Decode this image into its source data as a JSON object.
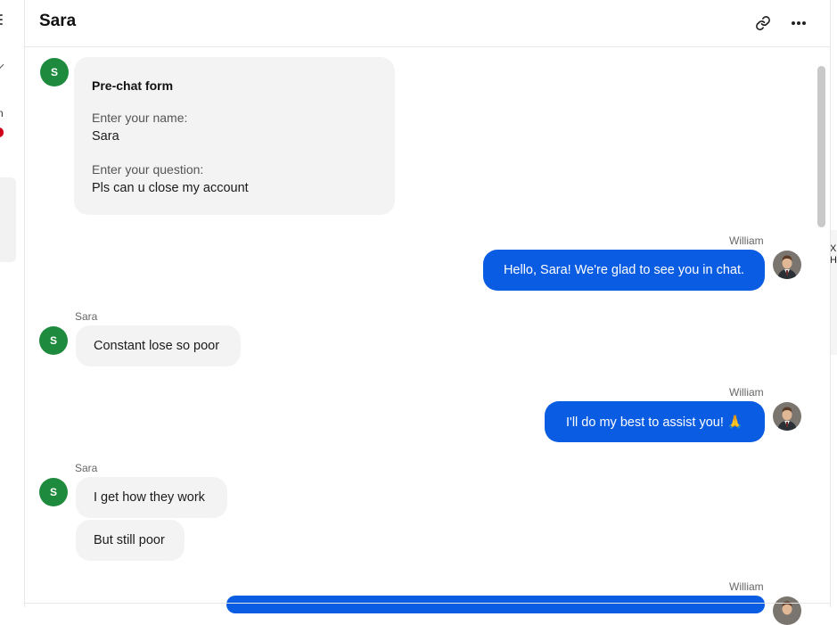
{
  "header": {
    "title": "Sara",
    "icons": [
      "link-icon",
      "more-icon"
    ]
  },
  "left_pane": {
    "letter": "n"
  },
  "right_pane": {
    "text_line1": "XI",
    "text_line2": "H"
  },
  "visitor": {
    "name": "Sara",
    "avatar_initial": "S",
    "avatar_color": "#1e8a3e"
  },
  "agent": {
    "name": "William"
  },
  "prechat_form": {
    "title": "Pre-chat form",
    "name_label": "Enter your name:",
    "name_value": "Sara",
    "question_label": "Enter your question:",
    "question_value": "Pls can u close my account"
  },
  "messages": [
    {
      "from": "William",
      "text": "Hello, Sara! We're glad to see you in chat."
    },
    {
      "from": "Sara",
      "text": "Constant lose so poor"
    },
    {
      "from": "William",
      "text": "I'll do my best to assist you! 🙏"
    },
    {
      "from": "Sara",
      "text": "I get how they work"
    },
    {
      "from": "Sara",
      "text": "But still poor"
    },
    {
      "from": "William",
      "text": ""
    }
  ],
  "colors": {
    "agent_bubble": "#0a5ce2",
    "visitor_bubble": "#f3f3f3"
  }
}
